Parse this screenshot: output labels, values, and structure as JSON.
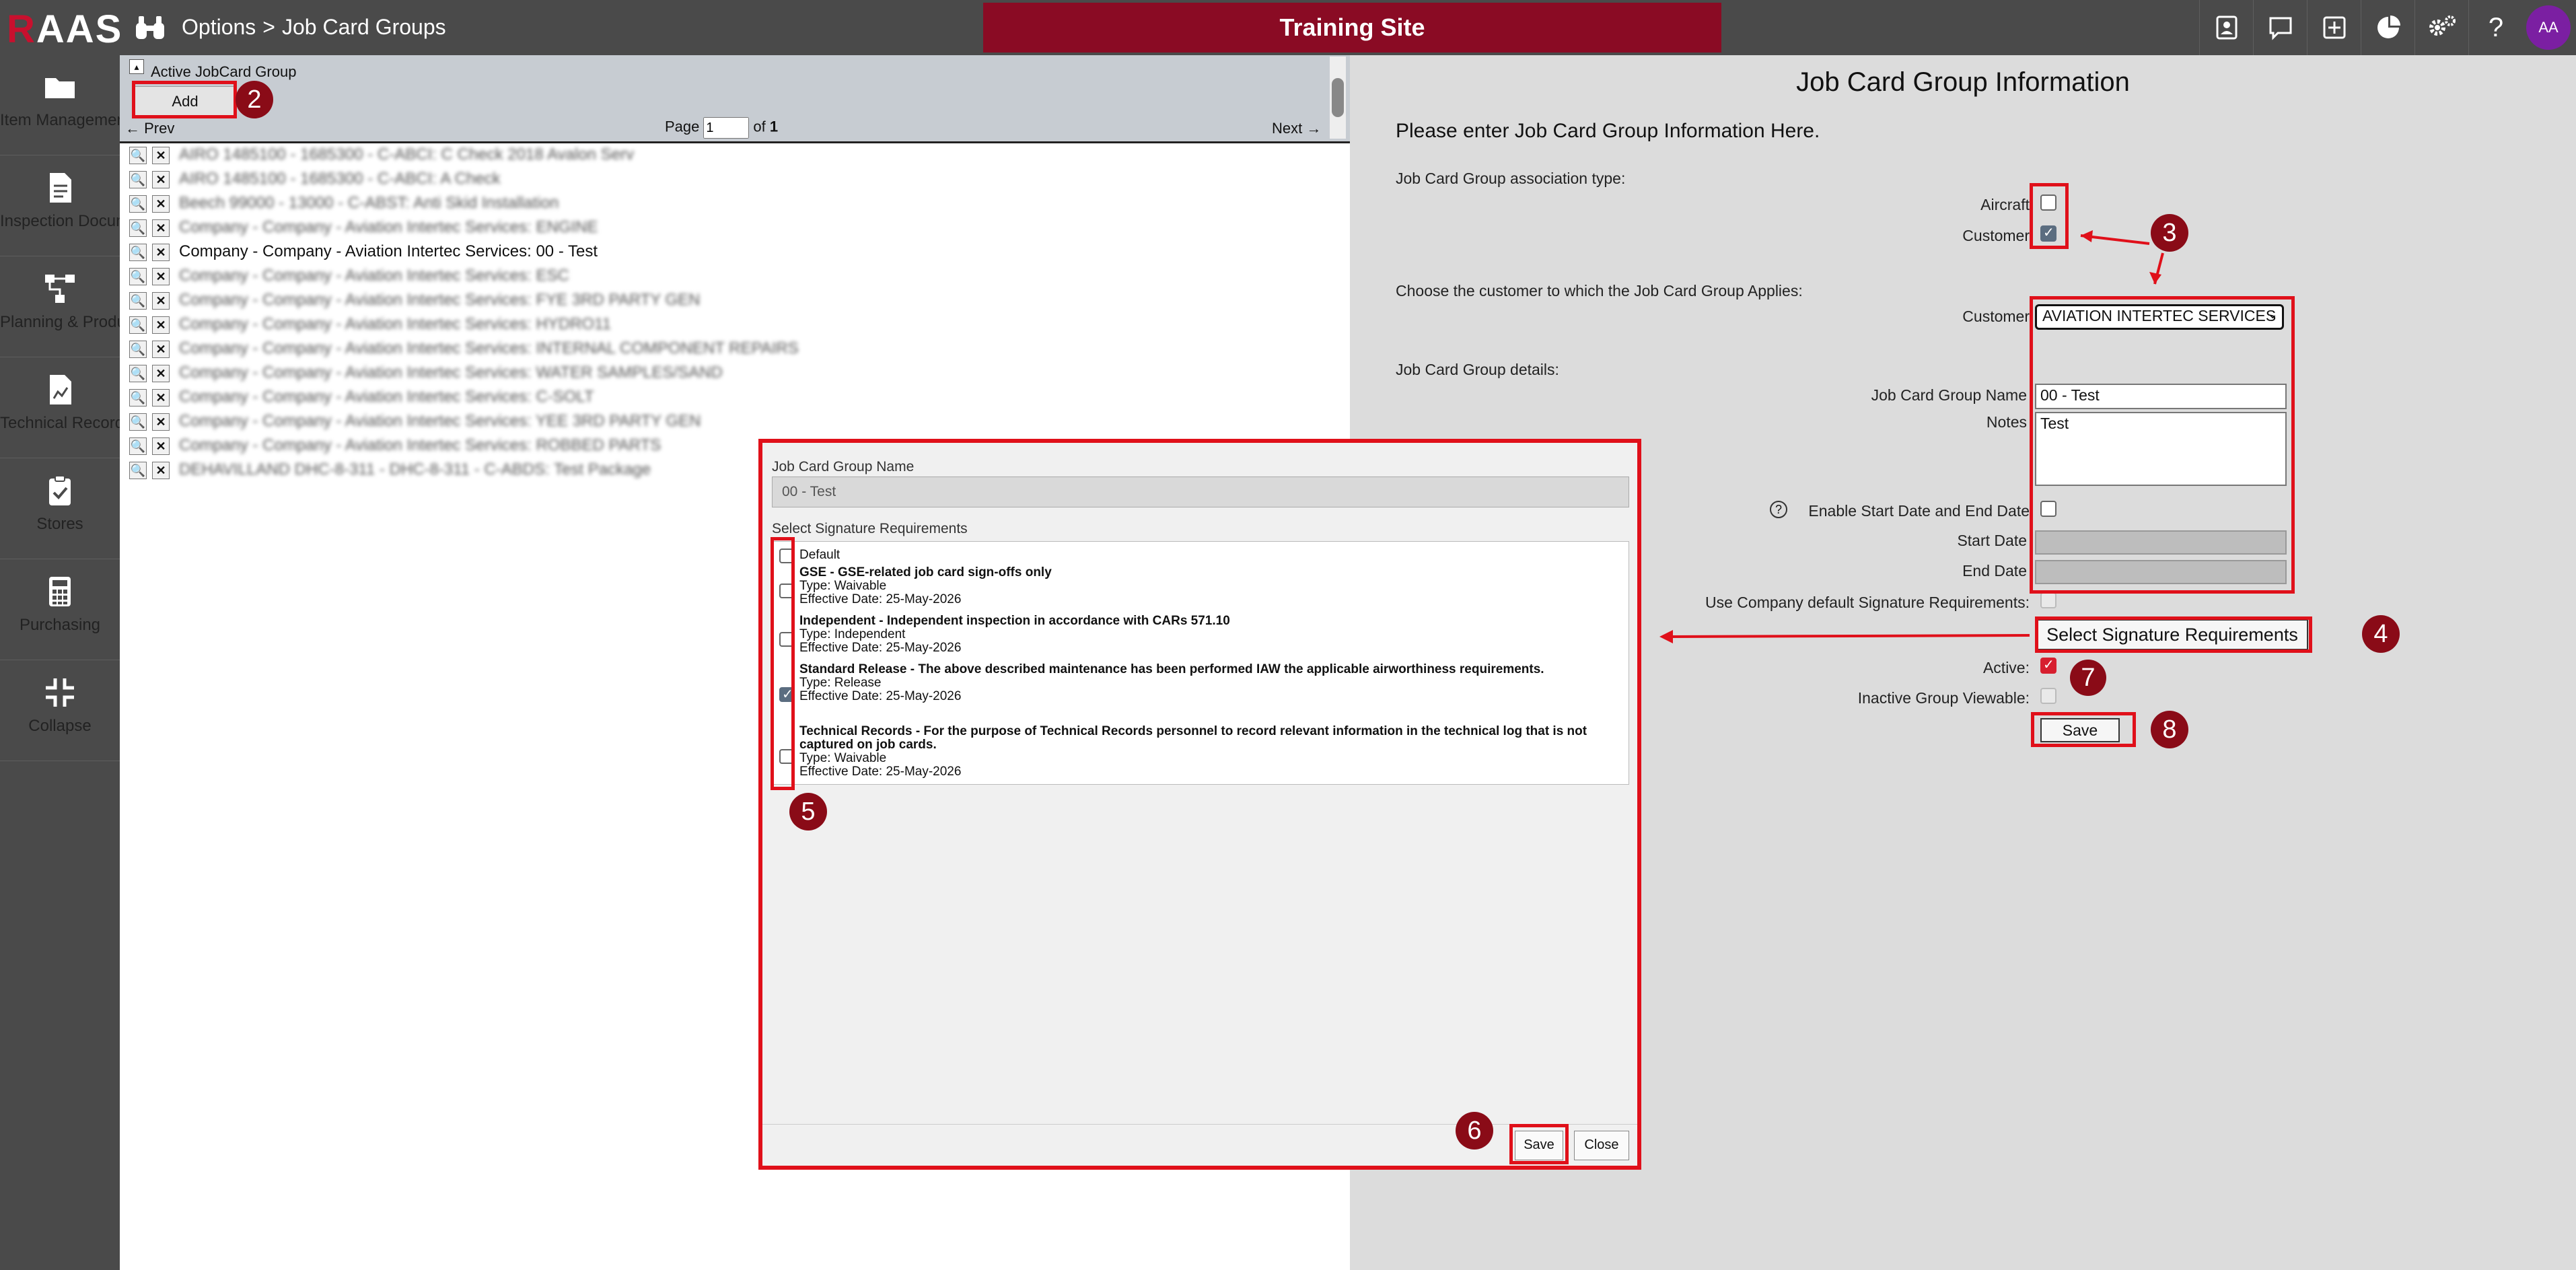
{
  "header": {
    "logo_r": "R",
    "logo_rest": "AAS",
    "breadcrumb_root": "Options",
    "breadcrumb_sep": ">",
    "breadcrumb_page": "Job Card Groups",
    "banner": "Training Site",
    "avatar_initials": "AA",
    "icons": [
      "contacts-icon",
      "chat-icon",
      "add-icon",
      "pie-chart-icon",
      "settings-icon",
      "help-icon"
    ]
  },
  "sidebar": {
    "items": [
      {
        "label": "Item Management",
        "icon": "folder-icon"
      },
      {
        "label": "Inspection Documents",
        "icon": "document-icon"
      },
      {
        "label": "Planning & Production",
        "icon": "workflow-icon"
      },
      {
        "label": "Technical Records",
        "icon": "records-icon"
      },
      {
        "label": "Stores",
        "icon": "clipboard-check-icon"
      },
      {
        "label": "Purchasing",
        "icon": "calculator-icon"
      },
      {
        "label": "Collapse",
        "icon": "collapse-icon"
      }
    ]
  },
  "list": {
    "title": "Active JobCard Group",
    "add_label": "Add",
    "prev_label": "← Prev",
    "next_label": "Next →",
    "page_label": "Page",
    "page_value": "1",
    "of_label": "of",
    "page_total": "1",
    "rows": [
      "AIRO 1485100 - 1685300 - C-ABCI: C Check 2018 Avalon Serv",
      "AIRO 1485100 - 1685300 - C-ABCI: A Check",
      "Beech 99000 - 13000 - C-ABST: Anti Skid Installation",
      "Company - Company - Aviation Intertec Services: ENGINE",
      "Company - Company - Aviation Intertec Services: 00 - Test",
      "Company - Company - Aviation Intertec Services: ESC",
      "Company - Company - Aviation Intertec Services: FYE 3RD PARTY GEN",
      "Company - Company - Aviation Intertec Services: HYDRO11",
      "Company - Company - Aviation Intertec Services: INTERNAL COMPONENT REPAIRS",
      "Company - Company - Aviation Intertec Services: WATER SAMPLES/SAND",
      "Company - Company - Aviation Intertec Services: C-SOLT",
      "Company - Company - Aviation Intertec Services: YEE 3RD PARTY GEN",
      "Company - Company - Aviation Intertec Services: ROBBED PARTS",
      "DEHAVILLAND DHC-8-311 - DHC-8-311 - C-ABDS: Test Package"
    ]
  },
  "info": {
    "title": "Job Card Group Information",
    "intro": "Please enter Job Card Group Information Here.",
    "assoc_label": "Job Card Group association type:",
    "aircraft_label": "Aircraft",
    "customer_label": "Customer",
    "choose_label": "Choose the customer to which the Job Card Group Applies:",
    "customer_select_label": "Customer",
    "customer_value": "AVIATION INTERTEC SERVICES",
    "details_label": "Job Card Group details:",
    "name_label": "Job Card Group Name",
    "name_value": "00 - Test",
    "notes_label": "Notes",
    "notes_value": "Test",
    "enable_dates_label": "Enable Start Date and End Date",
    "start_label": "Start Date",
    "end_label": "End Date",
    "use_default_label": "Use Company default Signature Requirements:",
    "select_sig_label": "Select Signature Requirements",
    "active_label": "Active:",
    "inactive_viewable_label": "Inactive Group Viewable:",
    "save_label": "Save"
  },
  "modal": {
    "name_label": "Job Card Group Name",
    "name_value": "00 - Test",
    "sig_label": "Select Signature Requirements",
    "default_label": "Default",
    "signatures": [
      {
        "title": "GSE - GSE-related job card sign-offs only",
        "type": "Type: Waivable",
        "date": "Effective Date: 25-May-2026",
        "checked": false
      },
      {
        "title": "Independent - Independent inspection in accordance with CARs 571.10",
        "type": "Type: Independent",
        "date": "Effective Date: 25-May-2026",
        "checked": false
      },
      {
        "title": "Standard Release - The above described maintenance has been performed IAW the applicable airworthiness requirements.",
        "type": "Type: Release",
        "date": "Effective Date: 25-May-2026",
        "checked": true
      },
      {
        "title": "Technical Records - For the purpose of Technical Records personnel to record relevant information in the technical log that is not captured on job cards.",
        "type": "Type: Waivable",
        "date": "Effective Date: 25-May-2026",
        "checked": false
      }
    ],
    "save_label": "Save",
    "close_label": "Close"
  },
  "callouts": [
    "2",
    "3",
    "4",
    "5",
    "6",
    "7",
    "8"
  ],
  "colors": {
    "brand_red": "#8a0b24",
    "annotation_red": "#e0101a",
    "chrome_dark": "#4a4a4a",
    "avatar_purple": "#7b1fa2"
  }
}
